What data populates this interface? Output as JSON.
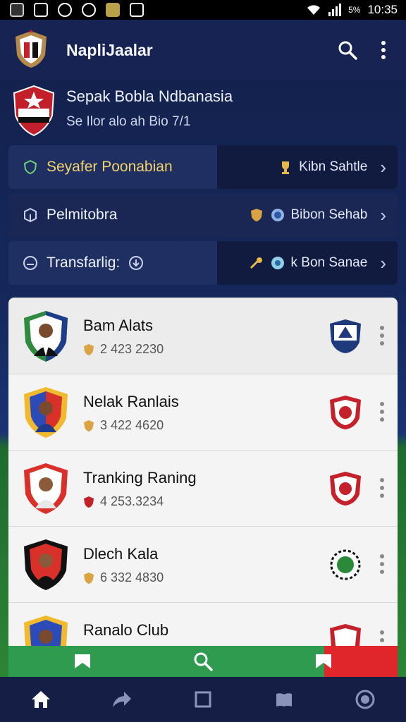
{
  "status_bar": {
    "time": "10:35",
    "battery_text": "5%"
  },
  "app_bar": {
    "title": "NapliJaalar",
    "icons": [
      "app-logo-icon",
      "search-icon",
      "more-vert-icon"
    ]
  },
  "league": {
    "title": "Sepak Bobla Ndbanasia",
    "subtitle": "Se Ilor alo ah Bio 7/1"
  },
  "menu_rows": [
    {
      "left_label": "Seyafer Poonabian",
      "right_label": "Kibn Sahtle"
    },
    {
      "left_label": "Pelmitobra",
      "right_label": "Bibon Sehab"
    },
    {
      "left_label": "Transfarlig:",
      "right_label": "k Bon Sanae"
    }
  ],
  "players": [
    {
      "name": "Bam Alats",
      "score": "2 423 2230"
    },
    {
      "name": "Nelak Ranlais",
      "score": "3 422 4620"
    },
    {
      "name": "Tranking Raning",
      "score": "4 253.3234"
    },
    {
      "name": "Dlech Kala",
      "score": "6 332 4830"
    },
    {
      "name": "Ranalo Club",
      "score": ""
    }
  ],
  "colors": {
    "appbar": "#172453",
    "accent_green": "#2e9b4e",
    "accent_red": "#e0262b",
    "gold": "#f2d36b"
  },
  "bottom_nav": [
    "home-icon",
    "share-icon",
    "square-icon",
    "book-icon",
    "circle-icon"
  ]
}
